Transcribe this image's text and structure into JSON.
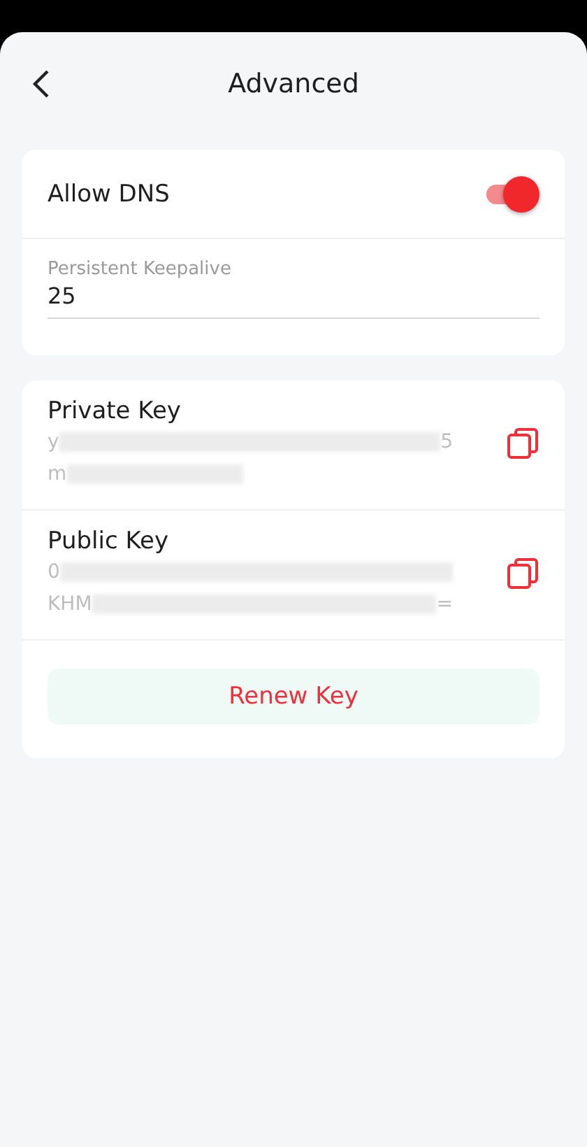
{
  "header": {
    "title": "Advanced"
  },
  "settings": {
    "allow_dns": {
      "label": "Allow DNS",
      "on": true
    },
    "keepalive": {
      "label": "Persistent Keepalive",
      "value": "25"
    }
  },
  "keys": [
    {
      "label": "Private Key",
      "lines": [
        {
          "start": "y",
          "end": "5"
        },
        {
          "start": "m"
        }
      ]
    },
    {
      "label": "Public Key",
      "lines": [
        {
          "start": "0"
        },
        {
          "start": "KHM",
          "end": "="
        }
      ]
    }
  ],
  "renew_button": "Renew Key"
}
